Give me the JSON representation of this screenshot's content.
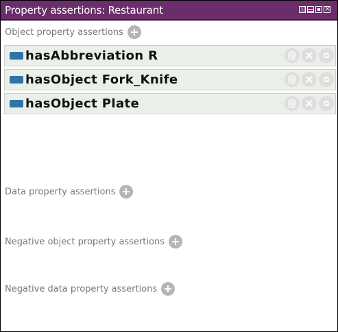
{
  "window": {
    "title": "Property assertions: Restaurant",
    "title_bar_color": "#6b2d6b"
  },
  "sections": {
    "object_props": {
      "label": "Object property assertions"
    },
    "data_props": {
      "label": "Data property assertions"
    },
    "neg_object_props": {
      "label": "Negative object property assertions"
    },
    "neg_data_props": {
      "label": "Negative data property assertions"
    }
  },
  "assertions": [
    {
      "text": "hasAbbreviation  R"
    },
    {
      "text": "hasObject  Fork_Knife"
    },
    {
      "text": "hasObject  Plate"
    }
  ],
  "icons": {
    "add": "add-circle-icon",
    "annotate": "at-sign-icon",
    "delete": "delete-x-icon",
    "explain": "info-circle-icon",
    "property": "object-property-icon"
  },
  "colors": {
    "row_background": "#eaf0e8",
    "property_icon": "#2f73a8",
    "action_button": "#dedede"
  }
}
